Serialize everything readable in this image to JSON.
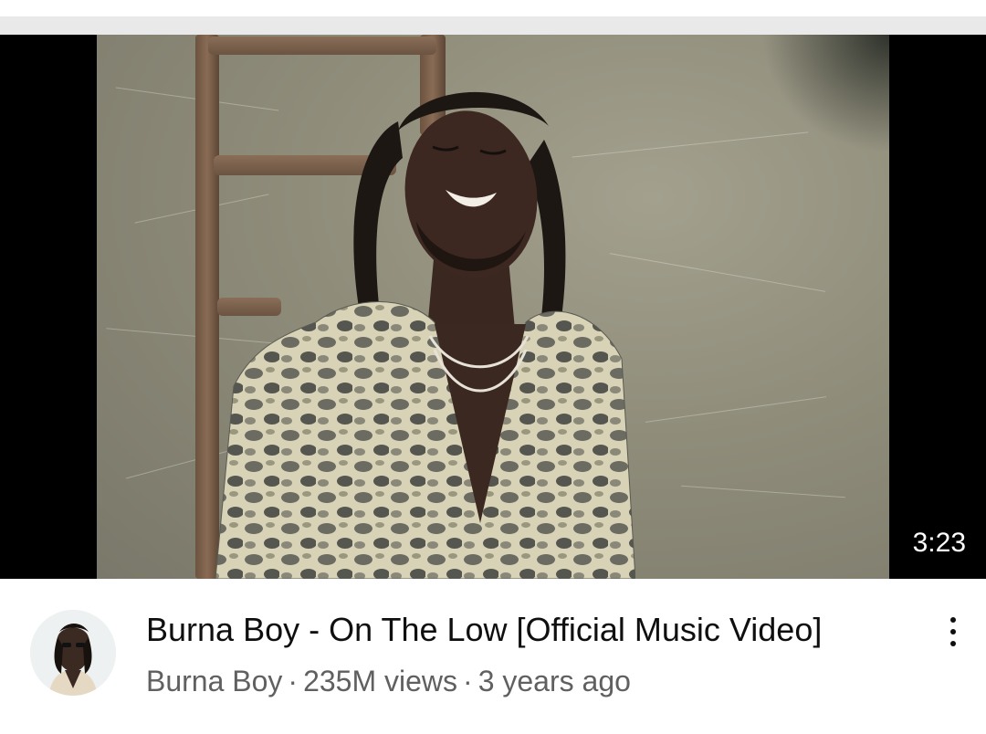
{
  "video": {
    "duration": "3:23",
    "title": "Burna Boy - On The Low [Official Music Video]",
    "channel": "Burna Boy",
    "views": "235M views",
    "age": "3 years ago",
    "separator": "·"
  },
  "icons": {
    "more": "more-vertical-icon",
    "avatar": "channel-avatar"
  },
  "colors": {
    "title": "#0f0f0f",
    "secondary": "#606060",
    "badge_bg": "#000000"
  }
}
